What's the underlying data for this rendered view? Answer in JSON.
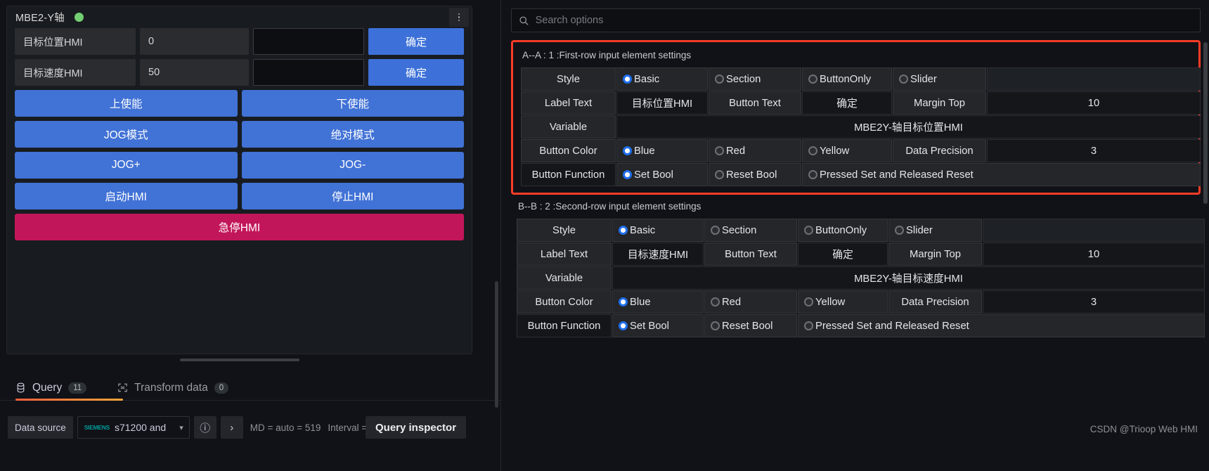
{
  "left_panel": {
    "title": "MBE2-Y轴",
    "status": "online",
    "menu_icon": "kebab-menu-icon",
    "input_rows": [
      {
        "label": "目标位置HMI",
        "value": "0",
        "input_value": "",
        "button": "确定"
      },
      {
        "label": "目标速度HMI",
        "value": "50",
        "input_value": "",
        "button": "确定"
      }
    ],
    "button_rows": [
      [
        "上使能",
        "下使能"
      ],
      [
        "JOG模式",
        "绝对模式"
      ],
      [
        "JOG+",
        "JOG-"
      ],
      [
        "启动HMI",
        "停止HMI"
      ]
    ],
    "stop_button": "急停HMI",
    "colors": {
      "blue": "#4172d6",
      "crimson": "#c2165a",
      "status_green": "#73cf73"
    }
  },
  "tabs": [
    {
      "label": "Query",
      "count": "11",
      "icon": "database-icon",
      "active": true
    },
    {
      "label": "Transform data",
      "count": "0",
      "icon": "transform-icon",
      "active": false
    }
  ],
  "query_bar": {
    "data_source_label": "Data source",
    "datasource_brand": "SIEMENS",
    "datasource_value": "s71200 and",
    "chevron": "chevron-down-icon",
    "help_icon": "help-circle-icon",
    "expand_icon": "chevron-right-icon",
    "md_text": "MD = auto = 519",
    "interval_text": "Interval =",
    "query_inspector": "Query inspector"
  },
  "search": {
    "placeholder": "Search options",
    "value": "",
    "icon": "search-icon"
  },
  "sections": [
    {
      "id": "A",
      "title": "A--A : 1 :First-row input element settings",
      "highlighted": true,
      "rows": [
        {
          "type": "radio",
          "label": "Style",
          "options": [
            {
              "label": "Basic",
              "selected": true
            },
            {
              "label": "Section",
              "selected": false
            },
            {
              "label": "ButtonOnly",
              "selected": false
            },
            {
              "label": "Slider",
              "selected": false
            }
          ],
          "trailing_label": "",
          "trailing_value": ""
        },
        {
          "type": "pairs",
          "cells": [
            {
              "label": "Label Text",
              "value": "目标位置HMI"
            },
            {
              "label": "Button Text",
              "value": "确定"
            },
            {
              "label": "Margin Top",
              "value": "10"
            }
          ]
        },
        {
          "type": "variable",
          "label": "Variable",
          "value": "MBE2Y-轴目标位置HMI"
        },
        {
          "type": "radio",
          "label": "Button Color",
          "options": [
            {
              "label": "Blue",
              "selected": true
            },
            {
              "label": "Red",
              "selected": false
            },
            {
              "label": "Yellow",
              "selected": false
            }
          ],
          "trailing_label": "Data Precision",
          "trailing_value": "3"
        },
        {
          "type": "radio-wide",
          "label": "Button Function",
          "options": [
            {
              "label": "Set Bool",
              "selected": true
            },
            {
              "label": "Reset Bool",
              "selected": false
            },
            {
              "label": "Pressed Set and Released Reset",
              "selected": false
            }
          ]
        }
      ]
    },
    {
      "id": "B",
      "title": "B--B : 2 :Second-row input element settings",
      "highlighted": false,
      "rows": [
        {
          "type": "radio",
          "label": "Style",
          "options": [
            {
              "label": "Basic",
              "selected": true
            },
            {
              "label": "Section",
              "selected": false
            },
            {
              "label": "ButtonOnly",
              "selected": false
            },
            {
              "label": "Slider",
              "selected": false
            }
          ],
          "trailing_label": "",
          "trailing_value": ""
        },
        {
          "type": "pairs",
          "cells": [
            {
              "label": "Label Text",
              "value": "目标速度HMI"
            },
            {
              "label": "Button Text",
              "value": "确定"
            },
            {
              "label": "Margin Top",
              "value": "10"
            }
          ]
        },
        {
          "type": "variable",
          "label": "Variable",
          "value": "MBE2Y-轴目标速度HMI"
        },
        {
          "type": "radio",
          "label": "Button Color",
          "options": [
            {
              "label": "Blue",
              "selected": true
            },
            {
              "label": "Red",
              "selected": false
            },
            {
              "label": "Yellow",
              "selected": false
            }
          ],
          "trailing_label": "Data Precision",
          "trailing_value": "3"
        },
        {
          "type": "radio-wide",
          "label": "Button Function",
          "options": [
            {
              "label": "Set Bool",
              "selected": true
            },
            {
              "label": "Reset Bool",
              "selected": false
            },
            {
              "label": "Pressed Set and Released Reset",
              "selected": false
            }
          ]
        }
      ]
    }
  ],
  "watermark": "CSDN @Trioop Web HMI",
  "accent_colors": {
    "highlight_border": "#f93c27",
    "radio_on": "#1f6fed",
    "tab_underline": "#f55f3e"
  }
}
